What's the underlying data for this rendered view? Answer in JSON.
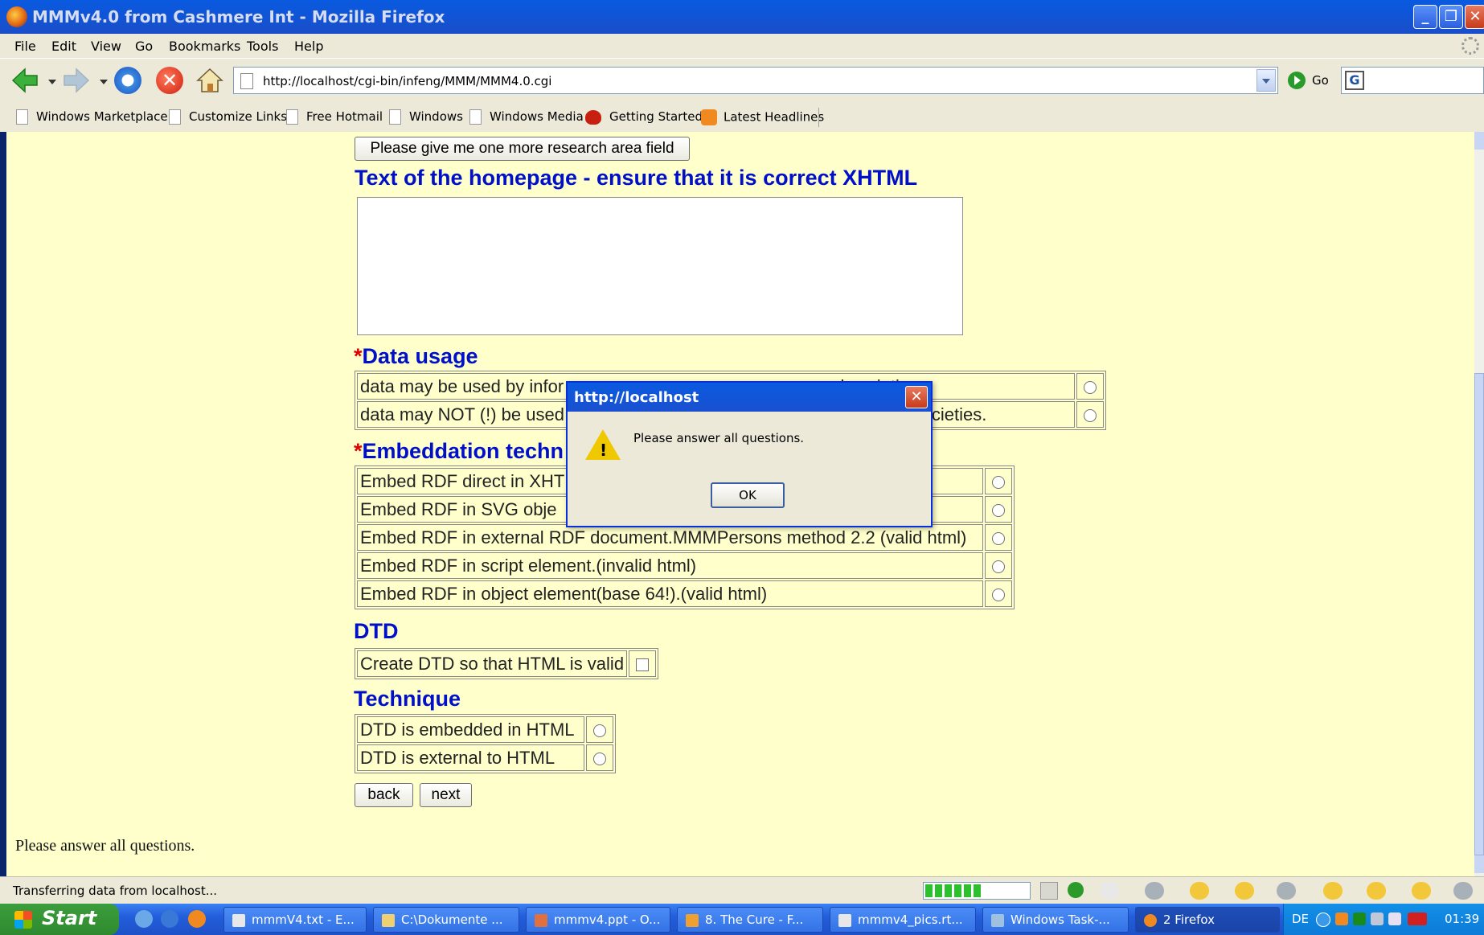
{
  "window": {
    "title": "MMMv4.0 from Cashmere Int - Mozilla Firefox",
    "minimize": "_",
    "maximize": "❐",
    "close": "✕"
  },
  "menu": [
    "File",
    "Edit",
    "View",
    "Go",
    "Bookmarks",
    "Tools",
    "Help"
  ],
  "nav": {
    "url": "http://localhost/cgi-bin/infeng/MMM/MMM4.0.cgi",
    "go_label": "Go",
    "stop_glyph": "✕"
  },
  "bookmarks": [
    "Windows Marketplace",
    "Customize Links",
    "Free Hotmail",
    "Windows",
    "Windows Media",
    "Getting Started",
    "Latest Headlines"
  ],
  "page": {
    "more_research_button": "Please give me one more research area field",
    "homepage_heading": "Text of the homepage - ensure that it is correct XHTML",
    "required_mark": "*",
    "data_usage_heading": "Data usage",
    "data_usage_options": [
      {
        "left": "data may be used by infor",
        "right": "d societies."
      },
      {
        "left": "data may NOT (!) be used",
        "right": "f learned societies."
      }
    ],
    "embed_heading": "Embeddation techn",
    "embed_options": [
      "Embed RDF direct in XHT",
      "Embed RDF in SVG obje",
      "Embed RDF in external RDF document.MMMPersons method 2.2 (valid html)",
      "Embed RDF in script element.(invalid html)",
      "Embed RDF in object element(base 64!).(valid html)"
    ],
    "dtd_heading": "DTD",
    "dtd_checkbox_label": "Create DTD so that HTML is valid",
    "technique_heading": "Technique",
    "technique_options": [
      "DTD is embedded in HTML",
      "DTD is external to HTML"
    ],
    "back_button": "back",
    "next_button": "next",
    "message": "Please answer all questions."
  },
  "dialog": {
    "title": "http://localhost",
    "close": "✕",
    "message": "Please answer all questions.",
    "warn_mark": "!",
    "ok": "OK"
  },
  "status": {
    "text": "Transferring data from localhost...",
    "progress_fraction": 0.55
  },
  "taskbar": {
    "start": "Start",
    "tasks": [
      "mmmV4.txt - E...",
      "C:\\Dokumente ...",
      "mmmv4.ppt - O...",
      "8. The Cure - F...",
      "mmmv4_pics.rt...",
      "Windows Task-...",
      "2 Firefox"
    ],
    "lang": "DE",
    "clock": "01:39"
  },
  "colors": {
    "page_background": "#ffffcc",
    "heading_blue": "#0010c8",
    "required_red": "#e00000"
  }
}
